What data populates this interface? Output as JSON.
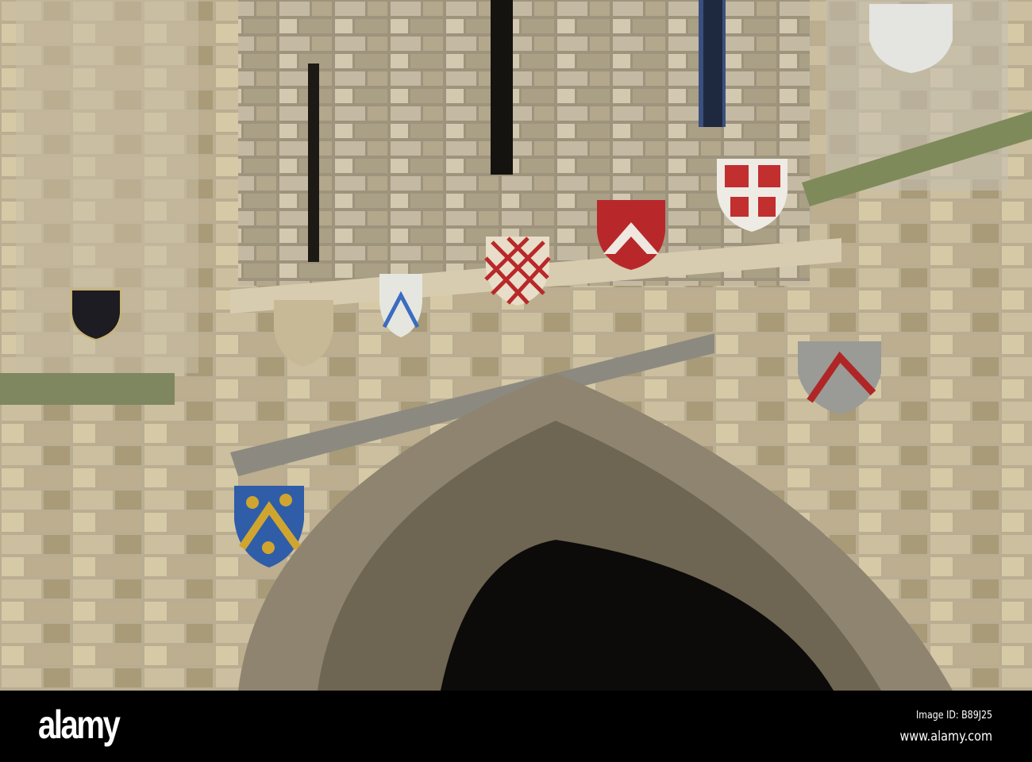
{
  "watermark": {
    "logo": "alamy",
    "image_id": "Image ID: B89J25",
    "url": "www.alamy.com"
  },
  "colors": {
    "stone_light": "#c9bfa8",
    "stone_mid": "#a89a7c",
    "stone_dark": "#6f6656",
    "archway_dark": "#0c0b0a",
    "heraldic_red": "#b8282a",
    "heraldic_blue": "#2f5da8",
    "heraldic_gold": "#d0a52f"
  }
}
